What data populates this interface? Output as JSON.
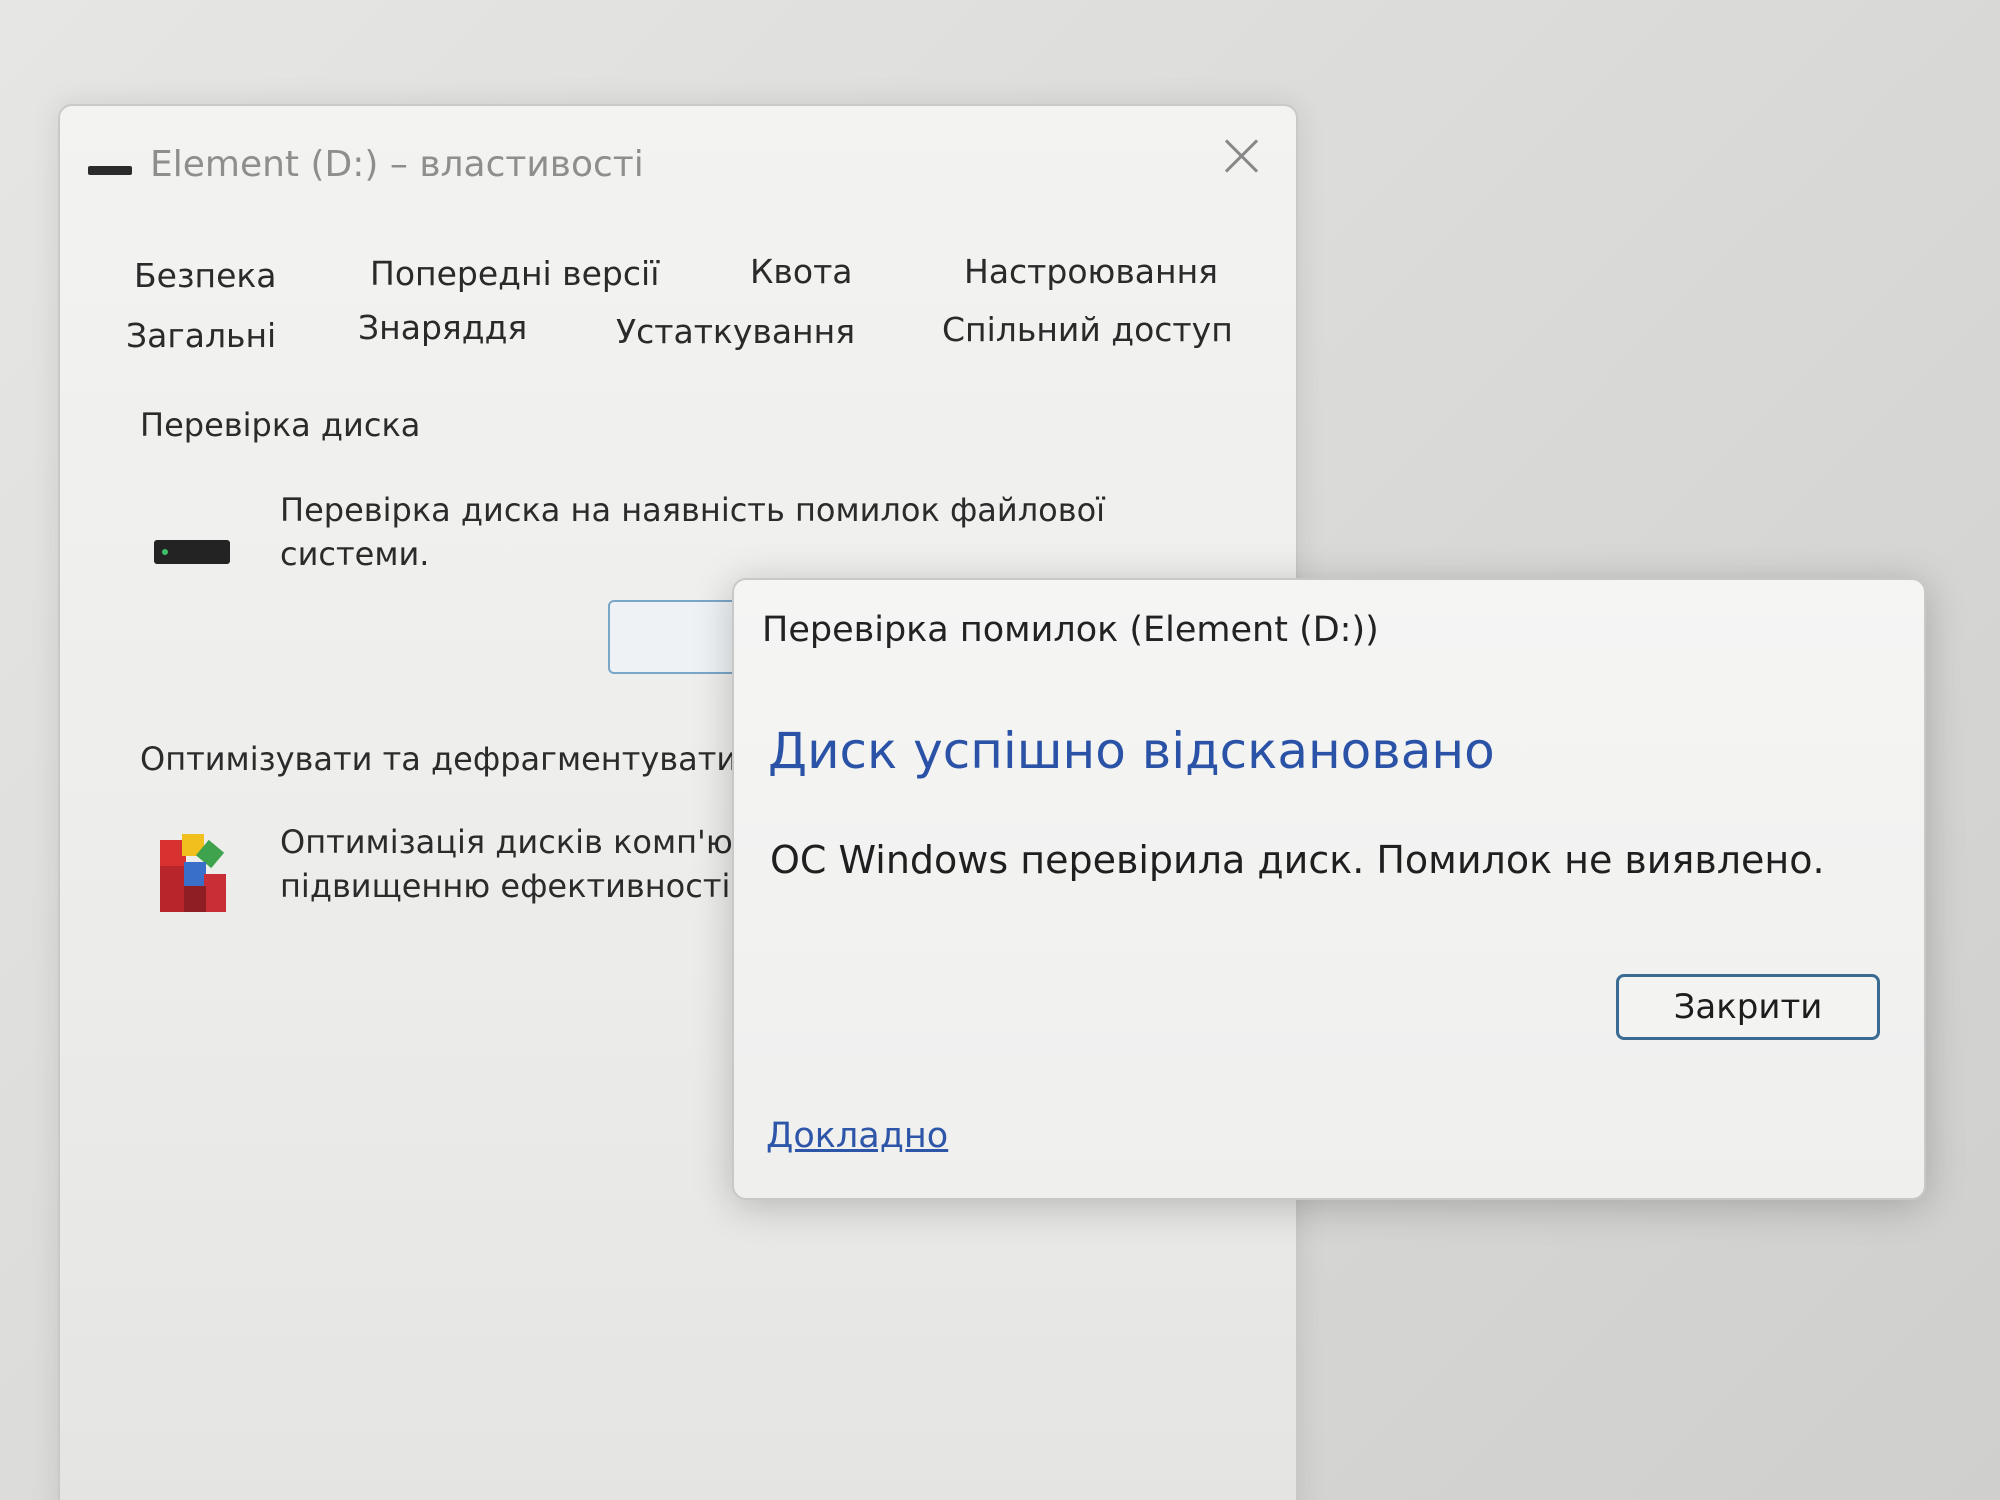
{
  "properties_window": {
    "title": "Element (D:) – властивості",
    "tabs_row1": [
      "Безпека",
      "Попередні версії",
      "Квота",
      "Настроювання"
    ],
    "tabs_row2": [
      "Загальні",
      "Знаряддя",
      "Устаткування",
      "Спільний доступ"
    ],
    "error_checking": {
      "heading": "Перевірка диска",
      "description_line1": "Перевірка диска на наявність помилок файлової",
      "description_line2": "системи."
    },
    "optimize": {
      "heading": "Оптимізувати та дефрагментувати",
      "description_line1": "Оптимізація дисків комп'ютера",
      "description_line2": "підвищенню ефективності"
    }
  },
  "dialog": {
    "title": "Перевірка помилок (Element (D:))",
    "heading": "Диск успішно відскановано",
    "message": "ОС Windows перевірила диск. Помилок не виявлено.",
    "close_label": "Закрити",
    "details_link": "Докладно"
  },
  "icons": {
    "drive": "drive-icon",
    "defrag": "defrag-icon",
    "close": "close-icon"
  },
  "colors": {
    "dialog_heading": "#2a52a6",
    "link": "#2d55a8",
    "button_border": "#3a6b93"
  }
}
